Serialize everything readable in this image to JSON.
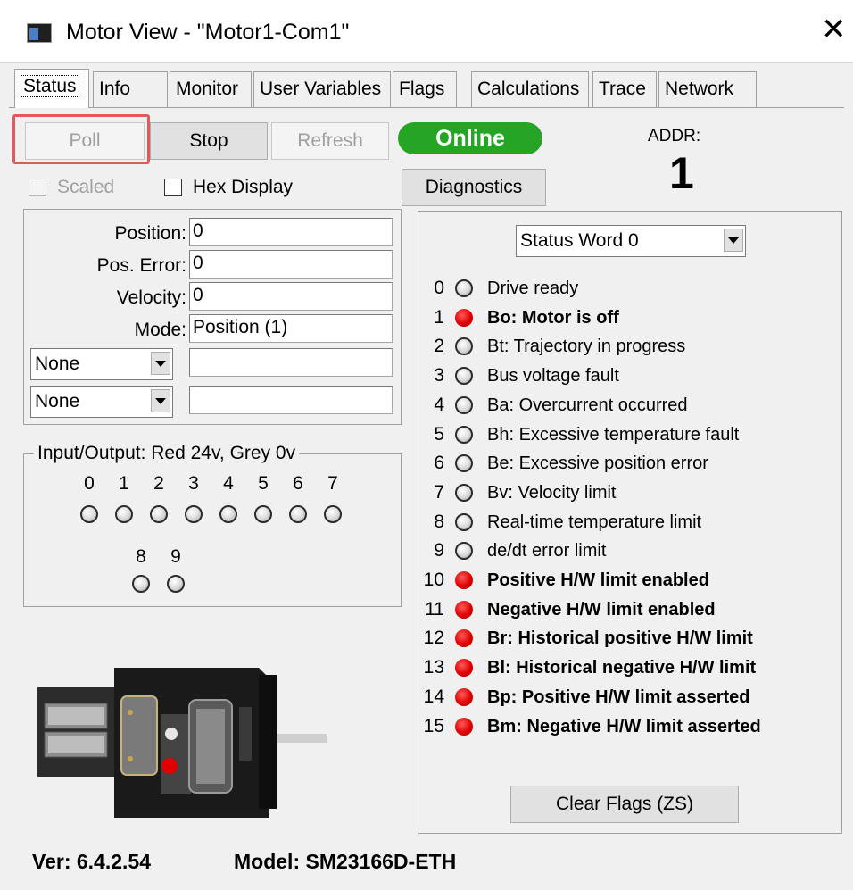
{
  "window": {
    "title": "Motor View - \"Motor1-Com1\""
  },
  "tabs": [
    {
      "label": "Status",
      "active": true
    },
    {
      "label": "Info"
    },
    {
      "label": "Monitor"
    },
    {
      "label": "User Variables"
    },
    {
      "label": "Flags"
    },
    {
      "label": "Calculations"
    },
    {
      "label": "Trace"
    },
    {
      "label": "Network"
    }
  ],
  "toolbar": {
    "poll": "Poll",
    "stop": "Stop",
    "refresh": "Refresh",
    "diagnostics": "Diagnostics",
    "online": "Online",
    "online_color": "#26a426",
    "addr_label": "ADDR:",
    "addr_value": "1"
  },
  "options": {
    "scaled": "Scaled",
    "hex_display": "Hex Display"
  },
  "fields": {
    "position_label": "Position:",
    "position_value": "0",
    "pos_error_label": "Pos. Error:",
    "pos_error_value": "0",
    "velocity_label": "Velocity:",
    "velocity_value": "0",
    "mode_label": "Mode:",
    "mode_value": "Position (1)",
    "select1": "None",
    "select1_value": "",
    "select2": "None",
    "select2_value": ""
  },
  "io": {
    "legend": "Input/Output: Red 24v, Grey 0v",
    "row1": [
      "0",
      "1",
      "2",
      "3",
      "4",
      "5",
      "6",
      "7"
    ],
    "row2": [
      "8",
      "9"
    ],
    "row1_states": [
      "grey",
      "grey",
      "grey",
      "grey",
      "grey",
      "grey",
      "grey",
      "grey"
    ],
    "row2_states": [
      "grey",
      "grey"
    ]
  },
  "status_word": {
    "selected": "Status Word 0",
    "bits": [
      {
        "num": "0",
        "label": "Drive ready",
        "on": false
      },
      {
        "num": "1",
        "label": "Bo:  Motor is off",
        "on": true
      },
      {
        "num": "2",
        "label": "Bt:  Trajectory in progress",
        "on": false
      },
      {
        "num": "3",
        "label": "Bus voltage fault",
        "on": false
      },
      {
        "num": "4",
        "label": "Ba:  Overcurrent occurred",
        "on": false
      },
      {
        "num": "5",
        "label": "Bh:  Excessive temperature fault",
        "on": false
      },
      {
        "num": "6",
        "label": "Be:  Excessive position error",
        "on": false
      },
      {
        "num": "7",
        "label": "Bv:  Velocity limit",
        "on": false
      },
      {
        "num": "8",
        "label": "Real-time temperature limit",
        "on": false
      },
      {
        "num": "9",
        "label": "de/dt error limit",
        "on": false
      },
      {
        "num": "10",
        "label": "Positive H/W limit enabled",
        "on": true
      },
      {
        "num": "11",
        "label": "Negative H/W limit enabled",
        "on": true
      },
      {
        "num": "12",
        "label": "Br:  Historical positive H/W limit",
        "on": true
      },
      {
        "num": "13",
        "label": "Bl:  Historical negative H/W limit",
        "on": true
      },
      {
        "num": "14",
        "label": "Bp:  Positive H/W limit asserted",
        "on": true
      },
      {
        "num": "15",
        "label": "Bm:  Negative H/W limit asserted",
        "on": true
      }
    ],
    "clear_flags": "Clear Flags (ZS)"
  },
  "footer": {
    "version": "Ver: 6.4.2.54",
    "model": "Model:  SM23166D-ETH"
  }
}
